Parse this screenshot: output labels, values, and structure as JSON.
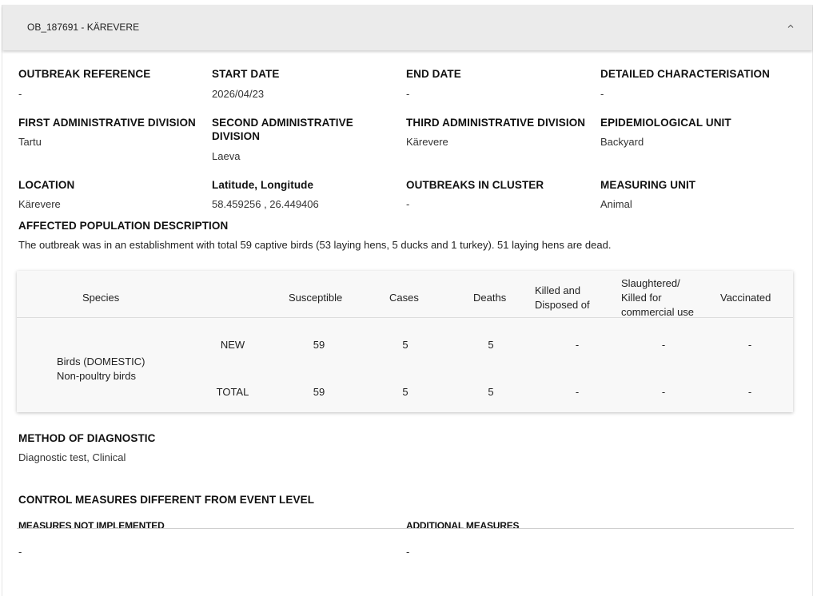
{
  "panel": {
    "title": "OB_187691 - KÄREVERE"
  },
  "fields": {
    "outbreak_reference": {
      "label": "OUTBREAK REFERENCE",
      "value": "-"
    },
    "start_date": {
      "label": "START DATE",
      "value": "2026/04/23"
    },
    "end_date": {
      "label": "END DATE",
      "value": "-"
    },
    "detailed_characterisation": {
      "label": "DETAILED CHARACTERISATION",
      "value": "-"
    },
    "first_admin": {
      "label": "FIRST ADMINISTRATIVE DIVISION",
      "value": "Tartu"
    },
    "second_admin": {
      "label_line1": "SECOND ADMINISTRATIVE",
      "label_line2": "DIVISION",
      "value": "Laeva"
    },
    "third_admin": {
      "label": "THIRD ADMINISTRATIVE DIVISION",
      "value": "Kärevere"
    },
    "epi_unit": {
      "label": "EPIDEMIOLOGICAL UNIT",
      "value": "Backyard"
    },
    "location": {
      "label": "LOCATION",
      "value": "Kärevere"
    },
    "lat_long": {
      "label": "Latitude, Longitude",
      "value": "58.459256 , 26.449406"
    },
    "outbreaks_in_cluster": {
      "label": "OUTBREAKS IN CLUSTER",
      "value": "-"
    },
    "measuring_unit": {
      "label": "MEASURING UNIT",
      "value": "Animal"
    }
  },
  "affected_population": {
    "label": "AFFECTED POPULATION DESCRIPTION",
    "text": "The outbreak was in an establishment with total 59 captive birds (53 laying hens, 5 ducks and 1 turkey). 51 laying hens are dead."
  },
  "table": {
    "headers": {
      "species": "Species",
      "susceptible": "Susceptible",
      "cases": "Cases",
      "deaths": "Deaths",
      "killed_line1": "Killed and",
      "killed_line2": "Disposed of",
      "slaughtered_line1": "Slaughtered/",
      "slaughtered_line2": "Killed for",
      "slaughtered_line3": "commercial use",
      "vaccinated": "Vaccinated"
    },
    "species_line1": "Birds (DOMESTIC)",
    "species_line2": "Non-poultry birds",
    "rows": [
      {
        "type": "NEW",
        "susceptible": "59",
        "cases": "5",
        "deaths": "5",
        "killed": "-",
        "slaughtered": "-",
        "vaccinated": "-"
      },
      {
        "type": "TOTAL",
        "susceptible": "59",
        "cases": "5",
        "deaths": "5",
        "killed": "-",
        "slaughtered": "-",
        "vaccinated": "-"
      }
    ]
  },
  "diagnostic": {
    "label": "METHOD OF DIAGNOSTIC",
    "value": "Diagnostic test, Clinical"
  },
  "control_measures": {
    "label": "CONTROL MEASURES DIFFERENT FROM EVENT LEVEL",
    "not_implemented": {
      "label": "MEASURES NOT IMPLEMENTED",
      "value": "-"
    },
    "additional": {
      "label": "ADDITIONAL MEASURES",
      "value": "-"
    }
  },
  "icons": {
    "collapse": "chevron-up-icon"
  }
}
